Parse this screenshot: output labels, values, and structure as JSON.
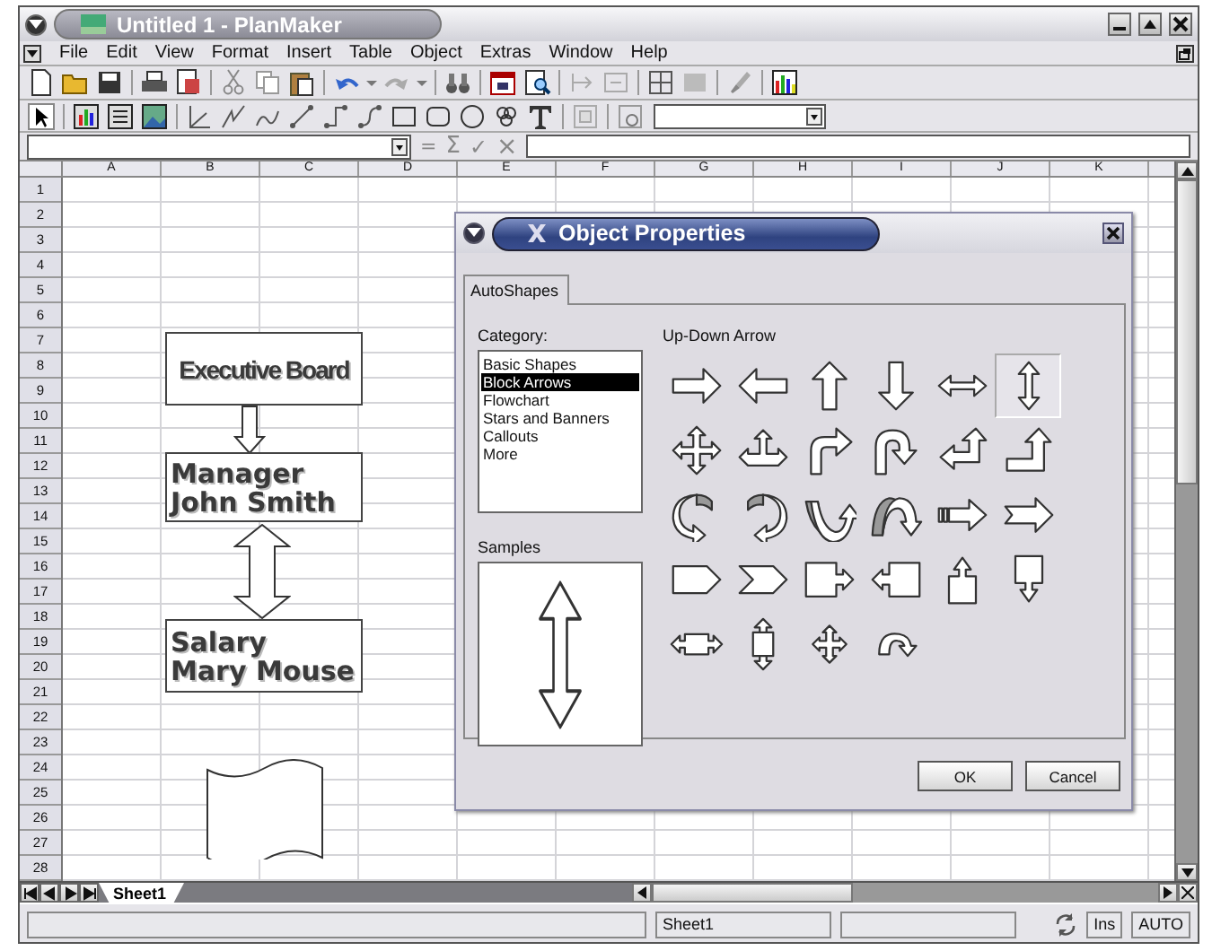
{
  "window": {
    "title": "Untitled 1 - PlanMaker"
  },
  "menu": [
    "File",
    "Edit",
    "View",
    "Format",
    "Insert",
    "Table",
    "Object",
    "Extras",
    "Window",
    "Help"
  ],
  "formula_bar": {
    "symbols": [
      {
        "kind": "equals",
        "label": "="
      },
      {
        "kind": "sum",
        "label": "Σ"
      },
      {
        "kind": "confirm",
        "label": "✓"
      },
      {
        "kind": "cancel",
        "label": "×"
      }
    ]
  },
  "sheet": {
    "columns": [
      "A",
      "B",
      "C",
      "D",
      "E",
      "F",
      "G",
      "H",
      "I",
      "J",
      "K"
    ],
    "rows": [
      "1",
      "2",
      "3",
      "4",
      "5",
      "6",
      "7",
      "8",
      "9",
      "10",
      "11",
      "12",
      "13",
      "14",
      "15",
      "16",
      "17",
      "18",
      "19",
      "20",
      "21",
      "22",
      "23",
      "24",
      "25",
      "26",
      "27",
      "28"
    ],
    "shapes": [
      {
        "kind": "textbox",
        "lines": [
          "Executive Board"
        ]
      },
      {
        "kind": "arrow-down"
      },
      {
        "kind": "textbox",
        "lines": [
          "Manager",
          "John Smith"
        ]
      },
      {
        "kind": "arrow-updown"
      },
      {
        "kind": "textbox",
        "lines": [
          "Salary",
          "Mary Mouse"
        ]
      },
      {
        "kind": "wave"
      }
    ]
  },
  "sheet_tabs": [
    {
      "label": "Sheet1",
      "selected": true
    }
  ],
  "status_bar": {
    "sheet": "Sheet1",
    "mode": "Ins",
    "calc": "AUTO"
  },
  "dialog": {
    "title": "Object Properties",
    "tabs": [
      {
        "label": "AutoShapes",
        "selected": true
      }
    ],
    "category_label": "Category:",
    "categories": [
      {
        "label": "Basic Shapes",
        "selected": false
      },
      {
        "label": "Block Arrows",
        "selected": true
      },
      {
        "label": "Flowchart",
        "selected": false
      },
      {
        "label": "Stars and Banners",
        "selected": false
      },
      {
        "label": "Callouts",
        "selected": false
      },
      {
        "label": "More",
        "selected": false
      }
    ],
    "samples_label": "Samples",
    "shape_name": "Up-Down Arrow",
    "shapes": [
      {
        "kind": "right",
        "selected": false
      },
      {
        "kind": "left",
        "selected": false
      },
      {
        "kind": "up",
        "selected": false
      },
      {
        "kind": "down",
        "selected": false
      },
      {
        "kind": "leftright",
        "selected": false
      },
      {
        "kind": "updown",
        "selected": true
      },
      {
        "kind": "quad",
        "selected": false
      },
      {
        "kind": "leftrightup",
        "selected": false
      },
      {
        "kind": "bent",
        "selected": false
      },
      {
        "kind": "uturn",
        "selected": false
      },
      {
        "kind": "leftup",
        "selected": false
      },
      {
        "kind": "bentup",
        "selected": false
      },
      {
        "kind": "curvedright",
        "selected": false
      },
      {
        "kind": "curvedleft",
        "selected": false
      },
      {
        "kind": "curvedup",
        "selected": false
      },
      {
        "kind": "curveddown",
        "selected": false
      },
      {
        "kind": "striped",
        "selected": false
      },
      {
        "kind": "notched",
        "selected": false
      },
      {
        "kind": "pentagon",
        "selected": false
      },
      {
        "kind": "chevron",
        "selected": false
      },
      {
        "kind": "rightcallout",
        "selected": false
      },
      {
        "kind": "leftcallout",
        "selected": false
      },
      {
        "kind": "upcallout",
        "selected": false
      },
      {
        "kind": "downcallout",
        "selected": false
      },
      {
        "kind": "lrcallout",
        "selected": false
      },
      {
        "kind": "udcallout",
        "selected": false
      },
      {
        "kind": "quadcallout",
        "selected": false
      },
      {
        "kind": "circular",
        "selected": false
      }
    ],
    "buttons": [
      "OK",
      "Cancel"
    ]
  }
}
